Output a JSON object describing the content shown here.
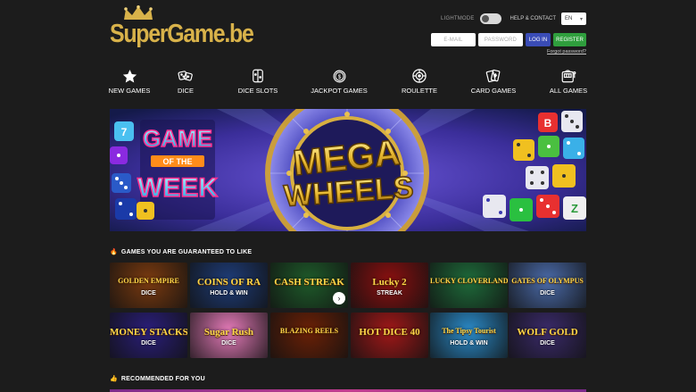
{
  "header": {
    "logo_text": "SuperGame.be",
    "lightmode_label": "LIGHTMODE",
    "help_label": "HELP & CONTACT",
    "language": "EN",
    "email_placeholder": "E-MAIL",
    "password_placeholder": "PASSWORD",
    "login_label": "LOG IN",
    "register_label": "REGISTER",
    "forgot_label": "Forgot password?"
  },
  "nav": [
    {
      "label": "NEW GAMES",
      "icon": "star-icon"
    },
    {
      "label": "DICE",
      "icon": "dice-icon"
    },
    {
      "label": "DICE SLOTS",
      "icon": "dice-slot-icon"
    },
    {
      "label": "JACKPOT GAMES",
      "icon": "jackpot-coin-icon"
    },
    {
      "label": "ROULETTE",
      "icon": "roulette-icon"
    },
    {
      "label": "CARD GAMES",
      "icon": "cards-icon"
    },
    {
      "label": "ALL GAMES",
      "icon": "slot-machine-icon"
    }
  ],
  "banner": {
    "left_line1": "GAME",
    "left_line2": "OF THE",
    "left_line3": "WEEK",
    "center_line1": "MEGA",
    "center_line2": "WHEELS"
  },
  "sections": {
    "guaranteed": "GAMES YOU ARE GUARANTEED TO LIKE",
    "recommended": "RECOMMENDED FOR YOU"
  },
  "games": [
    {
      "title": "GOLDEN EMPIRE",
      "sub": "DICE",
      "bg": "#7a3a10"
    },
    {
      "title": "COINS OF RA",
      "sub": "HOLD & WIN",
      "bg": "#1e3c78"
    },
    {
      "title": "CASH STREAK",
      "sub": "",
      "bg": "#1e5a2a"
    },
    {
      "title": "Lucky 2",
      "sub": "STREAK",
      "bg": "#8a1010"
    },
    {
      "title": "LUCKY CLOVERLAND",
      "sub": "",
      "bg": "#1e6a3a"
    },
    {
      "title": "GATES OF OLYMPUS",
      "sub": "DICE",
      "bg": "#4a6aa8"
    },
    {
      "title": "MONEY STACKS",
      "sub": "DICE",
      "bg": "#2a1e7a"
    },
    {
      "title": "Sugar Rush",
      "sub": "DICE",
      "bg": "#e47ab8"
    },
    {
      "title": "BLAZING REELS",
      "sub": "",
      "bg": "#6a2006"
    },
    {
      "title": "HOT DICE 40",
      "sub": "",
      "bg": "#a01818"
    },
    {
      "title": "The Tipsy Tourist",
      "sub": "HOLD & WIN",
      "bg": "#2a8ac8"
    },
    {
      "title": "WOLF GOLD",
      "sub": "DICE",
      "bg": "#3a2a6a"
    }
  ]
}
